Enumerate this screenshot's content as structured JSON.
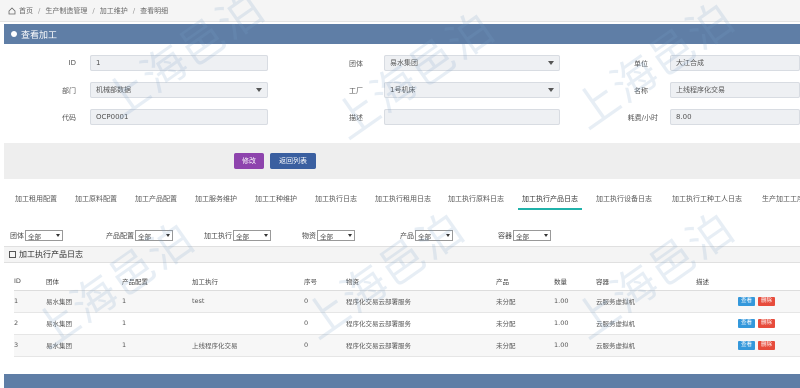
{
  "breadcrumb": [
    "首页",
    "生产制造管理",
    "加工维护",
    "查看明细"
  ],
  "panel_title": "查看加工",
  "form": {
    "id_label": "ID",
    "id_value": "1",
    "group_label": "团体",
    "group_value": "易水集团",
    "unit_label": "单位",
    "unit_value": "大江合成",
    "dept_label": "部门",
    "dept_value": "机械部数据",
    "factory_label": "工厂",
    "factory_value": "1号机床",
    "name_label": "名称",
    "name_value": "上线程序化交易",
    "code_label": "代码",
    "code_value": "OCP0001",
    "desc_label": "描述",
    "desc_value": "",
    "duration_label": "耗费/小时",
    "duration_value": "8.00"
  },
  "buttons": {
    "edit": "修改",
    "back": "返回列表"
  },
  "tabs": [
    "加工租用配置",
    "加工原料配置",
    "加工产品配置",
    "加工服务维护",
    "加工工种维护",
    "加工执行日志",
    "加工执行租用日志",
    "加工执行原料日志",
    "加工执行产品日志",
    "加工执行设备日志",
    "加工执行工种工人日志",
    "生产加工工序"
  ],
  "active_tab": "加工执行产品日志",
  "filters": [
    {
      "label": "团体",
      "value": "全部"
    },
    {
      "label": "产品配置",
      "value": "全部"
    },
    {
      "label": "加工执行",
      "value": "全部"
    },
    {
      "label": "物资",
      "value": "全部"
    },
    {
      "label": "产品",
      "value": "全部"
    },
    {
      "label": "容器",
      "value": "全部"
    }
  ],
  "subhead": "加工执行产品日志",
  "table": {
    "headers": [
      "ID",
      "团体",
      "产品配置",
      "加工执行",
      "序号",
      "物资",
      "产品",
      "数量",
      "容器",
      "描述",
      ""
    ],
    "rows": [
      [
        "1",
        "易水集团",
        "1",
        "test",
        "0",
        "程序化交易云部署服务",
        "未分配",
        "1.00",
        "云服务虚拟机",
        ""
      ],
      [
        "2",
        "易水集团",
        "1",
        "",
        "0",
        "程序化交易云部署服务",
        "未分配",
        "1.00",
        "云服务虚拟机",
        ""
      ],
      [
        "3",
        "易水集团",
        "1",
        "上线程序化交易",
        "0",
        "程序化交易云部署服务",
        "未分配",
        "1.00",
        "云服务虚拟机",
        ""
      ]
    ],
    "view_label": "查看",
    "delete_label": "删除"
  },
  "watermark": "上海邑泊"
}
